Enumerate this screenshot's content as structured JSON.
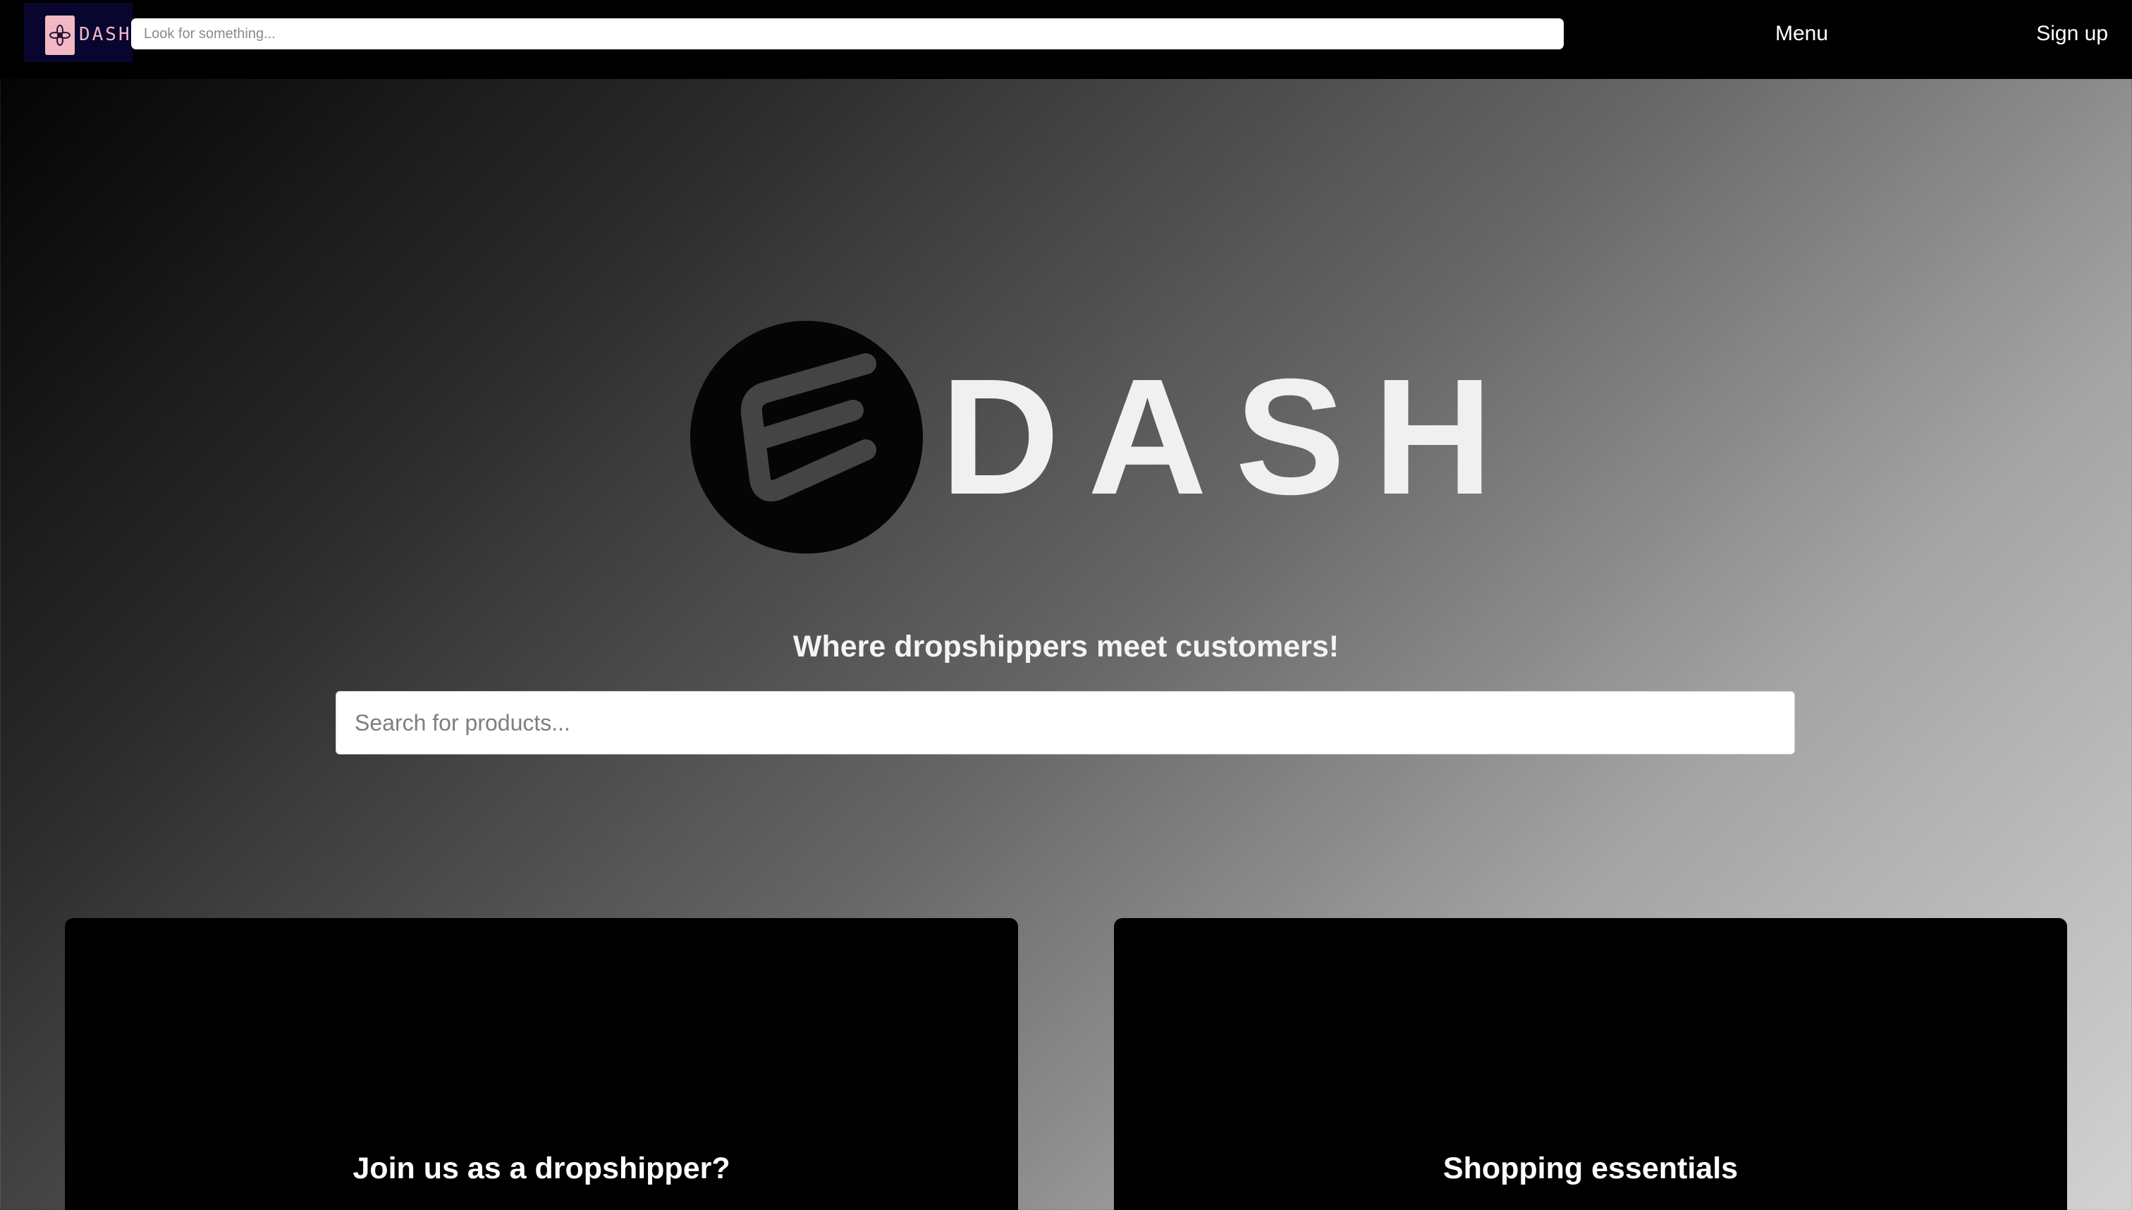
{
  "header": {
    "logo_text": "DASH",
    "search_placeholder": "Look for something...",
    "menu_label": "Menu",
    "signup_label": "Sign up"
  },
  "hero": {
    "brand": "DASH",
    "tagline": "Where dropshippers meet customers!",
    "search_placeholder": "Search for products..."
  },
  "cards": [
    {
      "title": "Join us as a dropshipper?"
    },
    {
      "title": "Shopping essentials"
    }
  ],
  "colors": {
    "topbar": "#000000",
    "logo_box": "#08062e",
    "logo_accent": "#f2b8c6",
    "card": "#000000",
    "brand_text": "#f0f0f0"
  },
  "icons": {
    "header_logo": "flower-icon",
    "hero_logo": "dash-e-logo-icon"
  }
}
